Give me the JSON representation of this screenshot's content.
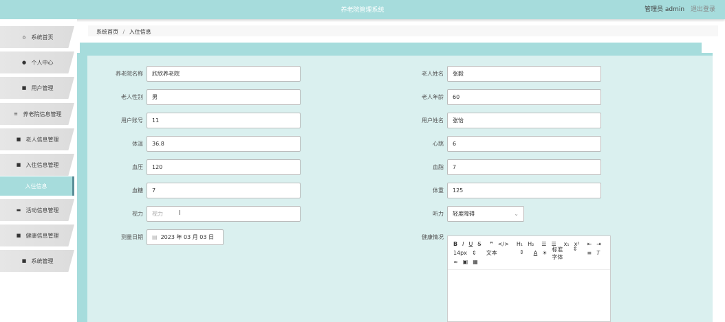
{
  "header": {
    "title": "养老院管理系统",
    "user_label": "管理员 admin",
    "logout_label": "退出登录"
  },
  "sidebar": {
    "items": [
      {
        "label": "系统首页",
        "icon": "house-icon",
        "glyph": "⌂"
      },
      {
        "label": "个人中心",
        "icon": "user-icon",
        "glyph": "●"
      },
      {
        "label": "用户管理",
        "icon": "grid-icon",
        "glyph": "■"
      },
      {
        "label": "养老院信息管理",
        "icon": "list-icon",
        "glyph": "≡"
      },
      {
        "label": "老人信息管理",
        "icon": "book-icon",
        "glyph": "■"
      },
      {
        "label": "入住信息管理",
        "icon": "grid-icon",
        "glyph": "■"
      },
      {
        "label": "活动信息管理",
        "icon": "monitor-icon",
        "glyph": "▬"
      },
      {
        "label": "健康信息管理",
        "icon": "document-icon",
        "glyph": "■"
      },
      {
        "label": "系统管理",
        "icon": "briefcase-icon",
        "glyph": "■"
      }
    ],
    "active_sub": "入住信息"
  },
  "breadcrumb": {
    "home": "系统首页",
    "separator": "/",
    "current": "入住信息"
  },
  "form": {
    "left": [
      {
        "label": "养老院名称",
        "value": "欣欣养老院"
      },
      {
        "label": "老人性别",
        "value": "男"
      },
      {
        "label": "用户账号",
        "value": "11"
      },
      {
        "label": "体温",
        "value": "36.8"
      },
      {
        "label": "血压",
        "value": "120"
      },
      {
        "label": "血糖",
        "value": "7"
      },
      {
        "label": "视力",
        "placeholder": "视力"
      },
      {
        "label": "测量日期",
        "value": "2023 年 03 月 03 日"
      }
    ],
    "right": [
      {
        "label": "老人姓名",
        "value": "张毅"
      },
      {
        "label": "老人年龄",
        "value": "60"
      },
      {
        "label": "用户姓名",
        "value": "张怡"
      },
      {
        "label": "心跳",
        "value": "6"
      },
      {
        "label": "血脂",
        "value": "7"
      },
      {
        "label": "体重",
        "value": "125"
      },
      {
        "label": "听力",
        "value": "轻度障碍"
      },
      {
        "label": "健康情况",
        "value": ""
      }
    ]
  },
  "editor": {
    "font_size": "14px",
    "block_type": "文本",
    "font_family": "标准字体"
  },
  "colors": {
    "accent": "#a6dcdc",
    "panel_bg": "#daf0ef",
    "sidebar_active": "#a6dcdc"
  }
}
